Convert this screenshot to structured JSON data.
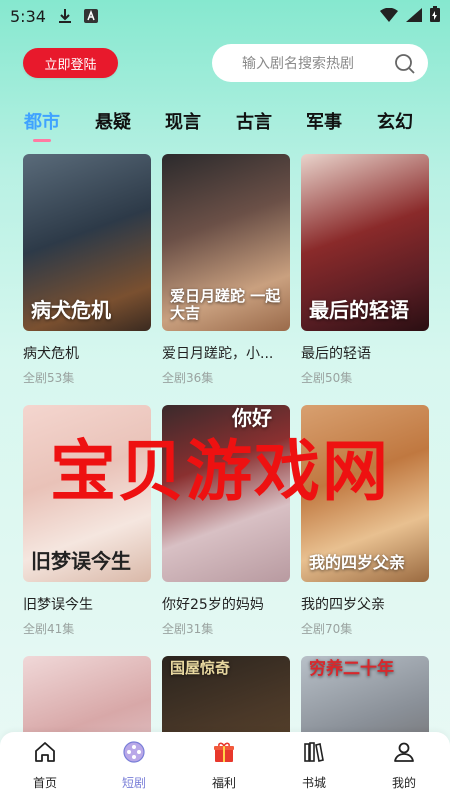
{
  "status_bar": {
    "time": "5:34",
    "icons": [
      "download-icon",
      "a-box-icon",
      "wifi-icon",
      "signal-icon",
      "battery-icon"
    ]
  },
  "header": {
    "login_label": "立即登陆",
    "search_placeholder": "输入剧名搜索热剧"
  },
  "tabs": [
    {
      "label": "都市",
      "active": true
    },
    {
      "label": "悬疑",
      "active": false
    },
    {
      "label": "现言",
      "active": false
    },
    {
      "label": "古言",
      "active": false
    },
    {
      "label": "军事",
      "active": false
    },
    {
      "label": "玄幻",
      "active": false
    }
  ],
  "cards": [
    {
      "title": "病犬危机",
      "episodes": "全剧53集",
      "poster_text": "病犬危机"
    },
    {
      "title": "爱日月蹉跎，小...",
      "episodes": "全剧36集",
      "poster_text": "爱日月蹉跎 一起大吉"
    },
    {
      "title": "最后的轻语",
      "episodes": "全剧50集",
      "poster_text": "最后的轻语"
    },
    {
      "title": "旧梦误今生",
      "episodes": "全剧41集",
      "poster_text": "旧梦误今生"
    },
    {
      "title": "你好25岁的妈妈",
      "episodes": "全剧31集",
      "poster_text": "你好"
    },
    {
      "title": "我的四岁父亲",
      "episodes": "全剧70集",
      "poster_text": "我的四岁父亲"
    },
    {
      "title": "",
      "episodes": "",
      "poster_text": ""
    },
    {
      "title": "",
      "episodes": "",
      "poster_text": "国屋惊奇"
    },
    {
      "title": "",
      "episodes": "",
      "poster_text": "穷养二十年"
    }
  ],
  "watermark": "宝贝游戏网",
  "bottom_nav": [
    {
      "label": "首页",
      "icon": "home-icon",
      "active": false
    },
    {
      "label": "短剧",
      "icon": "film-reel-icon",
      "active": true
    },
    {
      "label": "福利",
      "icon": "gift-icon",
      "active": false
    },
    {
      "label": "书城",
      "icon": "books-icon",
      "active": false
    },
    {
      "label": "我的",
      "icon": "user-icon",
      "active": false
    }
  ],
  "colors": {
    "accent_red": "#e8192c",
    "tab_active": "#3fa2ff",
    "nav_active": "#7a7fd8"
  }
}
